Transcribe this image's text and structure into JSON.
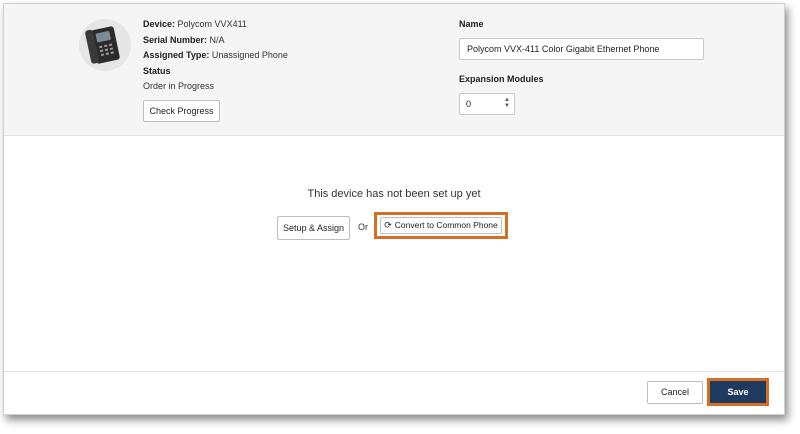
{
  "device": {
    "device_label": "Device:",
    "device_value": "Polycom VVX411",
    "serial_label": "Serial Number:",
    "serial_value": "N/A",
    "assigned_type_label": "Assigned Type:",
    "assigned_type_value": "Unassigned Phone",
    "status_label": "Status",
    "status_value": "Order in Progress",
    "check_progress_label": "Check Progress"
  },
  "form": {
    "name_label": "Name",
    "name_value": "Polycom VVX-411 Color Gigabit Ethernet Phone",
    "expansion_label": "Expansion Modules",
    "expansion_value": "0"
  },
  "setup": {
    "message": "This device has not been set up yet",
    "setup_assign_label": "Setup & Assign",
    "or_text": "Or",
    "convert_label": "Convert to Common Phone"
  },
  "footer": {
    "cancel_label": "Cancel",
    "save_label": "Save"
  },
  "colors": {
    "highlight": "#d56f23",
    "save_bg": "#1e3a5f",
    "header_bg": "#f5f5f5"
  }
}
